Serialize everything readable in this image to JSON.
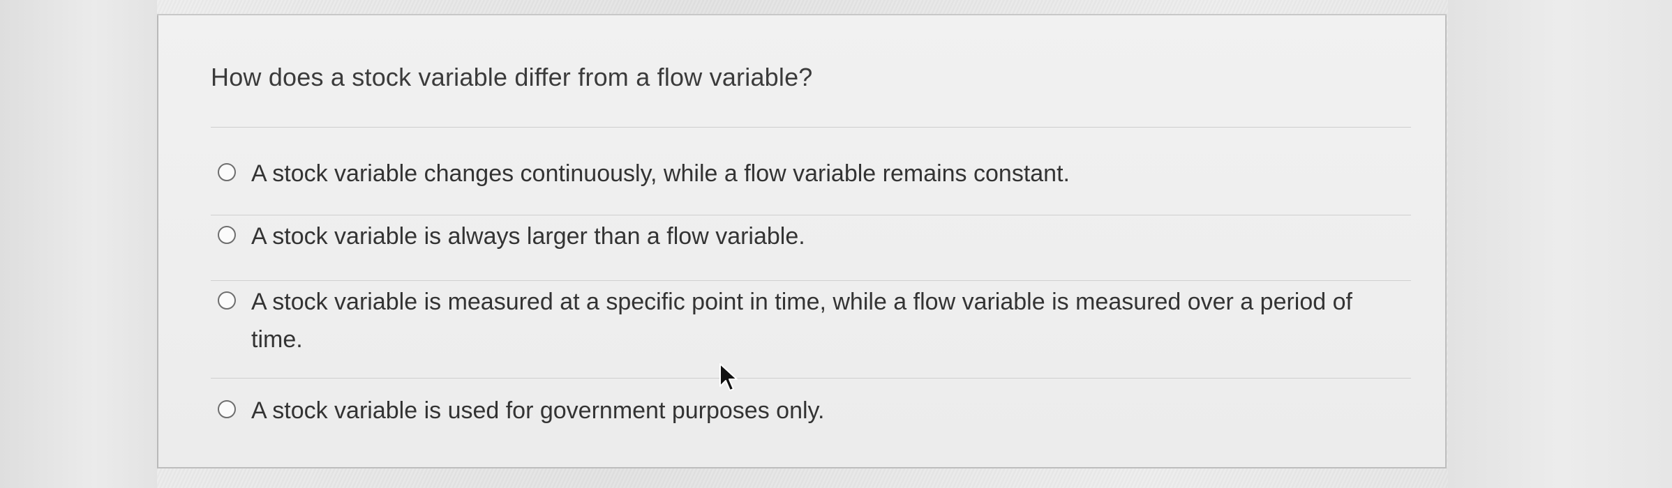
{
  "question": {
    "text": "How does a stock variable differ from a flow variable?"
  },
  "options": [
    {
      "label": "A stock variable changes continuously, while a flow variable remains constant."
    },
    {
      "label": "A stock variable is always larger than a flow variable."
    },
    {
      "label": "A stock variable is measured at a specific point in time, while a flow variable is measured over a period of time."
    },
    {
      "label": "A stock variable is used for government purposes only."
    }
  ],
  "cursor": {
    "icon": "arrow-pointer-icon"
  },
  "colors": {
    "card_background": "#eeeeee",
    "text": "#333333",
    "radio_border": "#6e6e6e",
    "rule": "#cfcfcf"
  }
}
